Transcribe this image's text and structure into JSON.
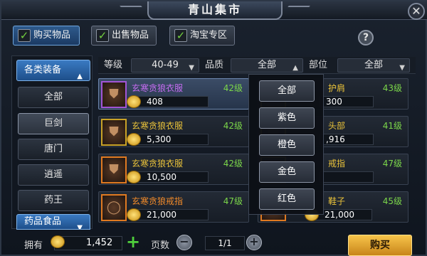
{
  "window": {
    "title": "青山集市",
    "close": "✕"
  },
  "tabs": [
    {
      "label": "购买物品",
      "checked": true
    },
    {
      "label": "出售物品",
      "checked": true
    },
    {
      "label": "淘宝专区",
      "checked": true
    }
  ],
  "help": "?",
  "sidebar": {
    "header": "各类装备",
    "items": [
      "全部",
      "巨剑",
      "唐门",
      "逍遥",
      "药王"
    ],
    "selected": "巨剑",
    "footer": "药品食品"
  },
  "filters": {
    "level_label": "等级",
    "level_value": "40-49",
    "quality_label": "品质",
    "quality_value": "全部",
    "slot_label": "部位",
    "slot_value": "全部"
  },
  "items_left": [
    {
      "name": "玄寒贪狼衣服",
      "level": "42级",
      "price": "408",
      "quality": "purple",
      "icon": "armor"
    },
    {
      "name": "玄寒贪狼衣服",
      "level": "42级",
      "price": "5,300",
      "quality": "gold",
      "icon": "armor"
    },
    {
      "name": "玄寒贪狼衣服",
      "level": "42级",
      "price": "10,500",
      "quality": "orange",
      "icon": "armor"
    },
    {
      "name": "玄寒贪狼戒指",
      "level": "47级",
      "price": "21,000",
      "quality": "orange",
      "icon": "ring"
    }
  ],
  "items_right": [
    {
      "name": "护肩",
      "level": "43级",
      "price": "300"
    },
    {
      "name": "头部",
      "level": "41级",
      "price": ",916"
    },
    {
      "name": "戒指",
      "level": "47级",
      "price": ""
    },
    {
      "name": "鞋子",
      "level": "45级",
      "price": "21,000"
    }
  ],
  "quality_dropdown": [
    "全部",
    "紫色",
    "橙色",
    "金色",
    "红色"
  ],
  "bottom": {
    "money_label": "拥有",
    "money": "1,452",
    "plus": "+",
    "page_label": "页数",
    "minus_btn": "−",
    "page": "1/1",
    "plus_btn": "+",
    "buy_label": "购买"
  },
  "colors": {
    "accent_blue": "#2e5a8c",
    "gold": "#e9c23a",
    "level_green": "#7bd64a",
    "buy": "#f7c44a"
  }
}
